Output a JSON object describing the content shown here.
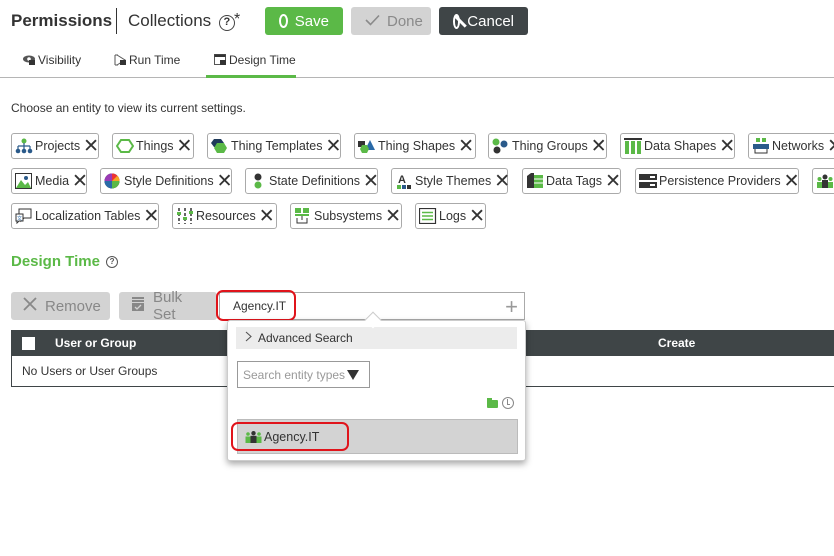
{
  "header": {
    "title": "Permissions",
    "subtitle": "Collections",
    "help": "?",
    "unsaved_marker": "*",
    "buttons": {
      "save": "Save",
      "done": "Done",
      "cancel": "Cancel"
    }
  },
  "tabs": [
    {
      "label": "Visibility",
      "icon": "visibility-lock-icon"
    },
    {
      "label": "Run Time",
      "icon": "run-time-lock-icon"
    },
    {
      "label": "Design Time",
      "icon": "design-time-lock-icon",
      "active": true
    }
  ],
  "instruction": "Choose an entity to view its current settings.",
  "entity_chips": [
    {
      "label": "Projects",
      "icon": "projects-icon"
    },
    {
      "label": "Things",
      "icon": "things-icon"
    },
    {
      "label": "Thing Templates",
      "icon": "thing-templates-icon"
    },
    {
      "label": "Thing Shapes",
      "icon": "thing-shapes-icon"
    },
    {
      "label": "Thing Groups",
      "icon": "thing-groups-icon"
    },
    {
      "label": "Data Shapes",
      "icon": "data-shapes-icon"
    },
    {
      "label": "Networks",
      "icon": "networks-icon"
    },
    {
      "label": "Media",
      "icon": "media-icon"
    },
    {
      "label": "Style Definitions",
      "icon": "style-definitions-icon"
    },
    {
      "label": "State Definitions",
      "icon": "state-definitions-icon"
    },
    {
      "label": "Style Themes",
      "icon": "style-themes-icon"
    },
    {
      "label": "Data Tags",
      "icon": "data-tags-icon"
    },
    {
      "label": "Persistence Providers",
      "icon": "persistence-providers-icon"
    },
    {
      "label": "",
      "icon": "user-groups-icon"
    },
    {
      "label": "Localization Tables",
      "icon": "localization-tables-icon"
    },
    {
      "label": "Resources",
      "icon": "resources-icon"
    },
    {
      "label": "Subsystems",
      "icon": "subsystems-icon"
    },
    {
      "label": "Logs",
      "icon": "logs-icon"
    }
  ],
  "chip_remove_glyph": "✕",
  "section": {
    "title": "Design Time",
    "help": "?"
  },
  "toolbar": {
    "remove": "Remove",
    "bulk_set": "Bulk Set",
    "search_value": "Agency.IT",
    "add_glyph": "+"
  },
  "table": {
    "columns": [
      "User or Group",
      "Create"
    ],
    "empty_message": "No Users or User Groups"
  },
  "dropdown": {
    "advanced_search": "Advanced Search",
    "entity_type_placeholder": "Search entity types",
    "results": [
      {
        "label": "Agency.IT",
        "icon": "user-group-icon"
      }
    ]
  },
  "colors": {
    "accent_green": "#5bb947",
    "dark": "#3f4547",
    "disabled": "#d3d3d3",
    "highlight_red": "#e0141b"
  }
}
